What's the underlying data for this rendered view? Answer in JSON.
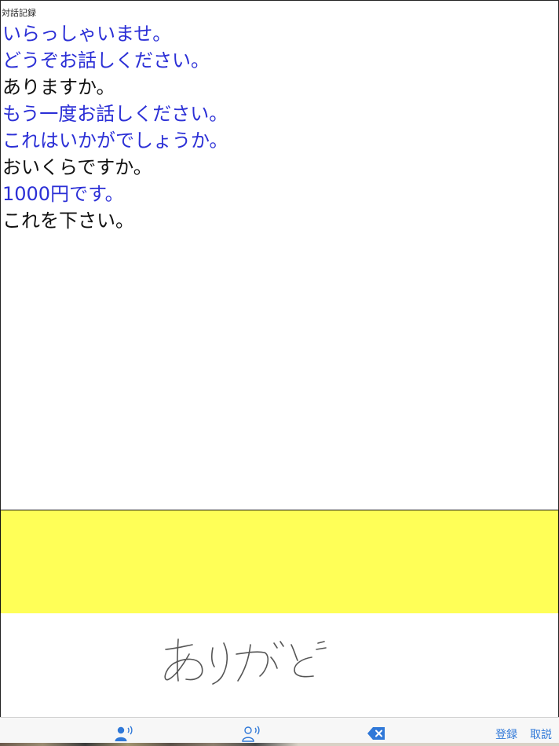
{
  "log": {
    "caption": "対話記録",
    "lines": [
      {
        "text": "いらっしゃいませ。",
        "speaker": "staff"
      },
      {
        "text": "どうぞお話しください。",
        "speaker": "staff"
      },
      {
        "text": "ありますか。",
        "speaker": "customer"
      },
      {
        "text": "もう一度お話しください。",
        "speaker": "staff"
      },
      {
        "text": "これはいかがでしょうか。",
        "speaker": "staff"
      },
      {
        "text": "おいくらですか。",
        "speaker": "customer"
      },
      {
        "text": "1000円です。",
        "speaker": "staff"
      },
      {
        "text": "これを下さい。",
        "speaker": "customer"
      }
    ],
    "colors": {
      "staff": "#2b2fd6",
      "customer": "#111111"
    }
  },
  "input_strip": {
    "color": "#ffff57"
  },
  "handwriting": {
    "text": "ありがとう",
    "ink_color": "#555555"
  },
  "toolbar": {
    "speaker_staff_icon": "person-speaking-filled-icon",
    "speaker_customer_icon": "person-speaking-outline-icon",
    "backspace_icon": "backspace-icon",
    "register_label": "登録",
    "cancel_label": "取説",
    "accent": "#2f78d8"
  }
}
